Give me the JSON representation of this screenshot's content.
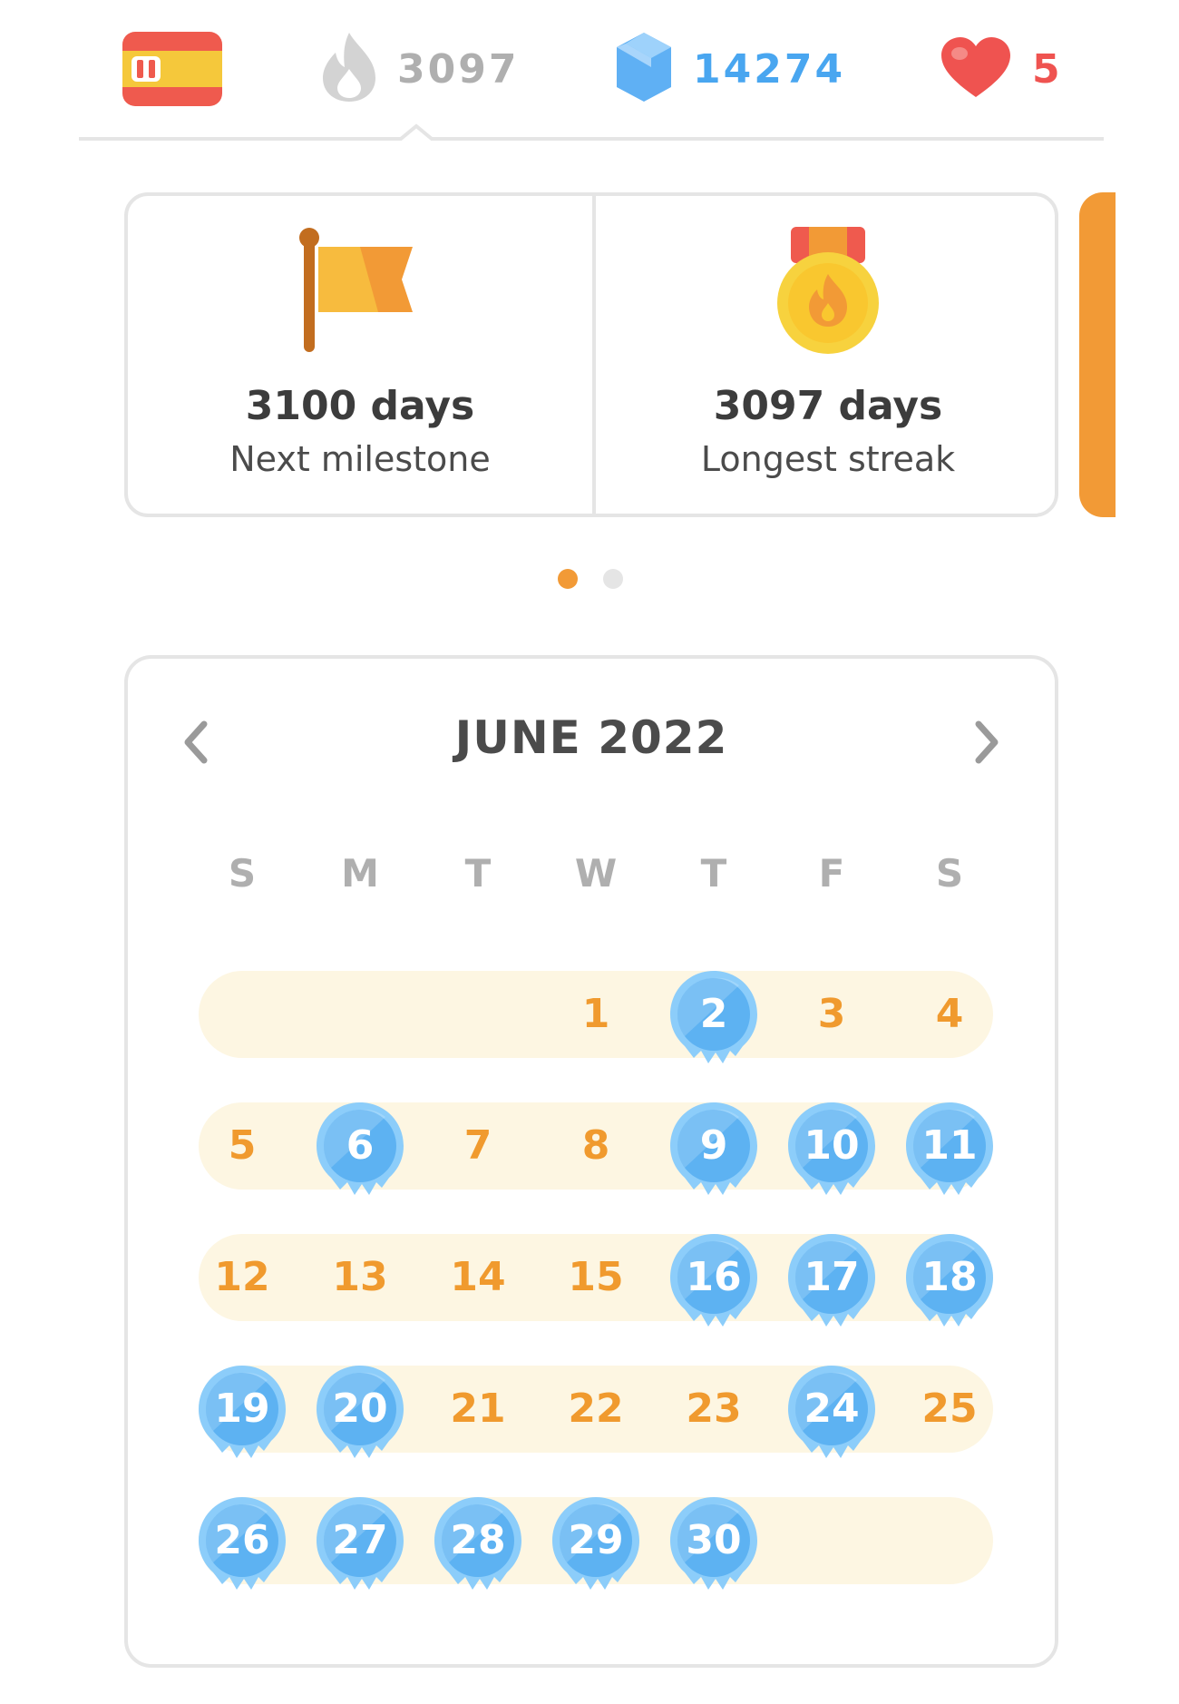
{
  "topbar": {
    "language_flag": "flag-spain",
    "streak_count": "3097",
    "gems_count": "14274",
    "hearts_count": "5",
    "colors": {
      "streak": "#afafaf",
      "gems": "#49a6f0",
      "hearts": "#f05c5c"
    }
  },
  "cards": [
    {
      "icon": "flag-icon",
      "value": "3100 days",
      "label": "Next milestone"
    },
    {
      "icon": "medal-icon",
      "value": "3097 days",
      "label": "Longest streak"
    }
  ],
  "pager": {
    "count": 2,
    "active_index": 0
  },
  "calendar": {
    "month_label": "JUNE 2022",
    "weekdays": [
      "S",
      "M",
      "T",
      "W",
      "T",
      "F",
      "S"
    ],
    "days_in_month": 30,
    "first_weekday_index": 3,
    "active_days": [
      2,
      6,
      9,
      10,
      11,
      16,
      17,
      18,
      19,
      20,
      24,
      26,
      27,
      28,
      29,
      30
    ],
    "colors": {
      "inactive_day": "#f09a2e",
      "active_day_fill": "#5db2f2",
      "band": "#fdf6e2"
    }
  }
}
